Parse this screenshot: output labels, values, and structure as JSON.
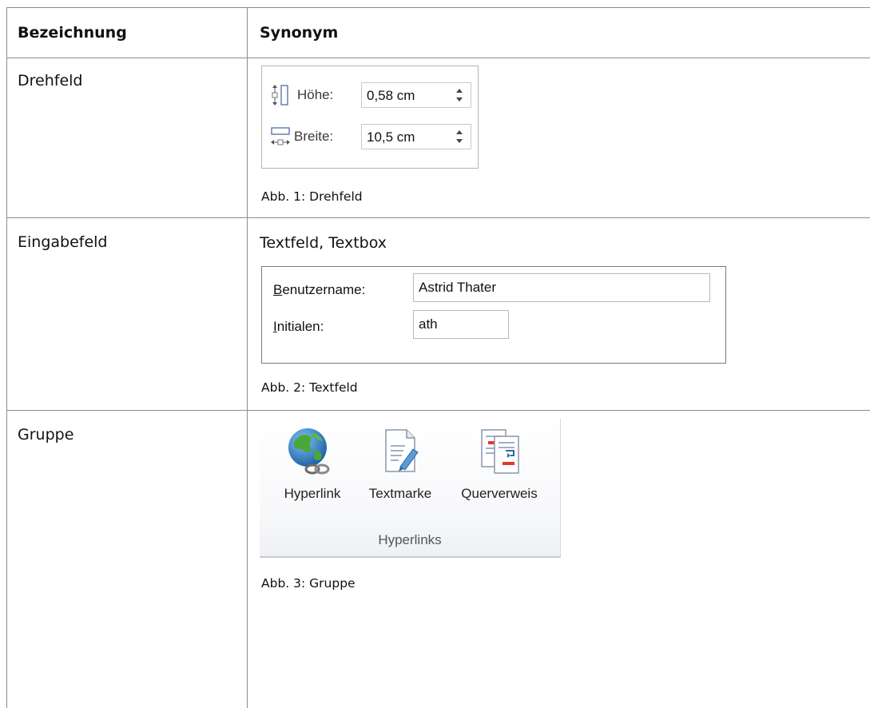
{
  "table": {
    "header": {
      "col1": "Bezeichnung",
      "col2": "Synonym"
    },
    "rows": [
      {
        "term": "Drehfeld",
        "synonym": "",
        "caption": "Abb. 1: Drehfeld"
      },
      {
        "term": "Eingabefeld",
        "synonym": "Textfeld, Textbox",
        "caption": "Abb. 2: Textfeld"
      },
      {
        "term": "Gruppe",
        "synonym": "",
        "caption": "Abb. 3: Gruppe"
      }
    ]
  },
  "fig_spinner": {
    "height": {
      "label": "Höhe:",
      "value": "0,58  cm"
    },
    "width": {
      "label": "Breite:",
      "value": "10,5  cm"
    }
  },
  "fig_textfield": {
    "username": {
      "accel": "B",
      "label_rest": "enutzername:",
      "value": "Astrid Thater"
    },
    "initials": {
      "accel": "I",
      "label_rest": "nitialen:",
      "value": "ath"
    }
  },
  "fig_ribbon": {
    "buttons": [
      {
        "label": "Hyperlink",
        "icon": "globe-link-icon"
      },
      {
        "label": "Textmarke",
        "icon": "bookmark-page-icon"
      },
      {
        "label": "Querverweis",
        "icon": "cross-reference-icon"
      }
    ],
    "group_label": "Hyperlinks"
  },
  "colors": {
    "grid": "#8c8c8c",
    "panel_border": "#b5b5b5",
    "marker_red": "#e0392b"
  }
}
